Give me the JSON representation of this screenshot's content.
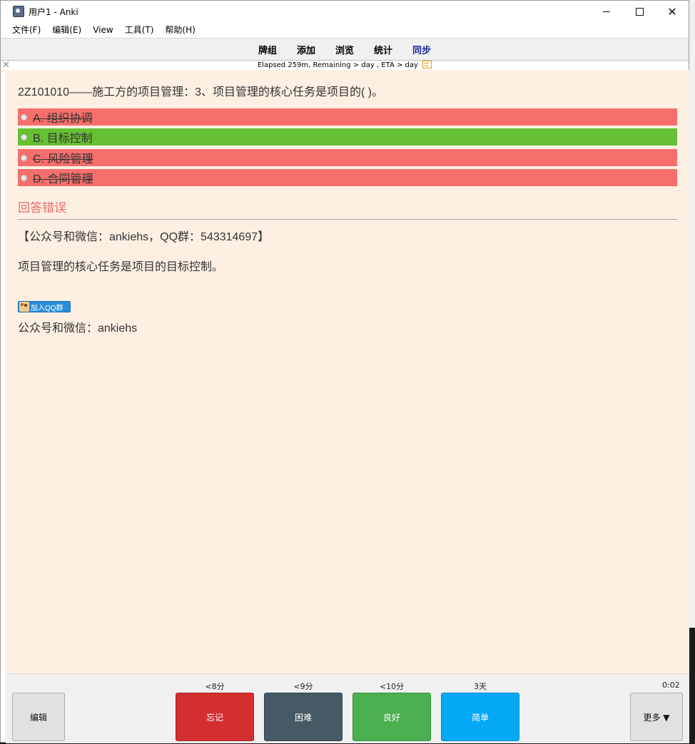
{
  "window": {
    "title": "用户1 - Anki"
  },
  "menu": [
    "文件(F)",
    "编辑(E)",
    "View",
    "工具(T)",
    "帮助(H)"
  ],
  "toolbar": {
    "decks": "牌组",
    "add": "添加",
    "browse": "浏览",
    "stats": "统计",
    "sync": "同步"
  },
  "status": {
    "text": "Elapsed 259m, Remaining > day , ETA > day"
  },
  "card": {
    "question": "2Z101010——施工方的项目管理：3、项目管理的核心任务是项目的( )。",
    "options": [
      {
        "label": "A. 组织协调",
        "state": "wrong"
      },
      {
        "label": "B. 目标控制",
        "state": "correct"
      },
      {
        "label": "C. 风险管理",
        "state": "wrong"
      },
      {
        "label": "D. 合同管理",
        "state": "wrong"
      }
    ],
    "result": "回答错误",
    "source": "【公众号和微信：ankiehs，QQ群：543314697】",
    "explanation": "项目管理的核心任务是项目的目标控制。",
    "qq_badge": "加入QQ群",
    "footer": "公众号和微信：ankiehs"
  },
  "answer_bar": {
    "edit": "编辑",
    "more": "更多 ▼",
    "timer": "0:02",
    "buttons": [
      {
        "label": "忘记",
        "interval": "<8分",
        "color": "#d32f2f"
      },
      {
        "label": "困难",
        "interval": "<9分",
        "color": "#455a64"
      },
      {
        "label": "良好",
        "interval": "<10分",
        "color": "#4caf50"
      },
      {
        "label": "简单",
        "interval": "3天",
        "color": "#03a9f4"
      }
    ]
  },
  "colors": {
    "card_bg": "#fdf0e3",
    "wrong": "#f66f6c",
    "correct": "#67bf34",
    "result": "#f06a6a"
  }
}
